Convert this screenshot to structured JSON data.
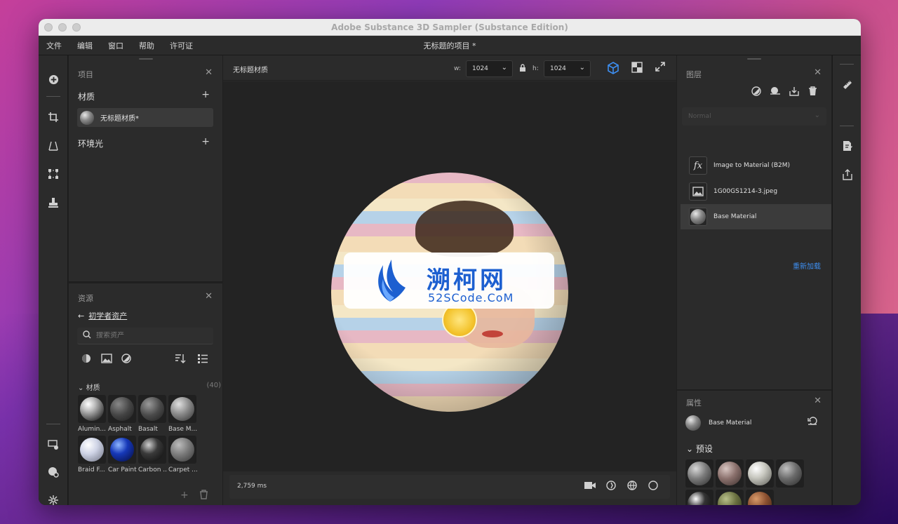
{
  "window": {
    "title": "Adobe Substance 3D Sampler (Substance Edition)",
    "doc_title": "无标题的项目 *"
  },
  "menu": [
    "文件",
    "编辑",
    "窗口",
    "帮助",
    "许可证"
  ],
  "left_tools": [
    {
      "icon": "add-circle-icon"
    },
    {
      "icon": "crop-icon"
    },
    {
      "icon": "perspective-icon"
    },
    {
      "icon": "transform-icon"
    },
    {
      "icon": "stamp-icon"
    },
    {
      "icon": "display-settings-icon"
    },
    {
      "icon": "environment-settings-icon"
    },
    {
      "icon": "tiling-icon"
    }
  ],
  "project": {
    "title": "项目",
    "materials_label": "材质",
    "material_item": "无标题材质*",
    "env_label": "环境光"
  },
  "assets": {
    "title": "资源",
    "back_label": "初学者资产",
    "search_placeholder": "搜索资产",
    "category": "材质",
    "count": "(40)",
    "items": [
      {
        "name": "Alumin..."
      },
      {
        "name": "Asphalt"
      },
      {
        "name": "Basalt"
      },
      {
        "name": "Base M..."
      },
      {
        "name": "Braid F..."
      },
      {
        "name": "Car Paint"
      },
      {
        "name": "Carbon ..."
      },
      {
        "name": "Carpet ..."
      }
    ]
  },
  "viewport": {
    "material_name": "无标题材质",
    "w_label": "w:",
    "w_value": "1024",
    "h_label": "h:",
    "h_value": "1024",
    "render_time": "2,759 ms"
  },
  "watermark": {
    "title": "溯柯网",
    "subtitle": "52SCode.CoM"
  },
  "layers": {
    "title": "图层",
    "blend_mode": "Normal",
    "items": [
      {
        "label": "Image to Material (B2M)",
        "icon": "fx-icon"
      },
      {
        "label": "1G00GS1214-3.jpeg",
        "icon": "image-icon"
      },
      {
        "label": "Base Material",
        "icon": "material-sphere-icon"
      }
    ],
    "reload_label": "重新加载"
  },
  "properties": {
    "title": "属性",
    "item": "Base Material",
    "presets_label": "预设"
  },
  "colors": {
    "accent": "#3d8ef0",
    "panel": "#2b2b2b",
    "bg": "#1f1f1f"
  }
}
